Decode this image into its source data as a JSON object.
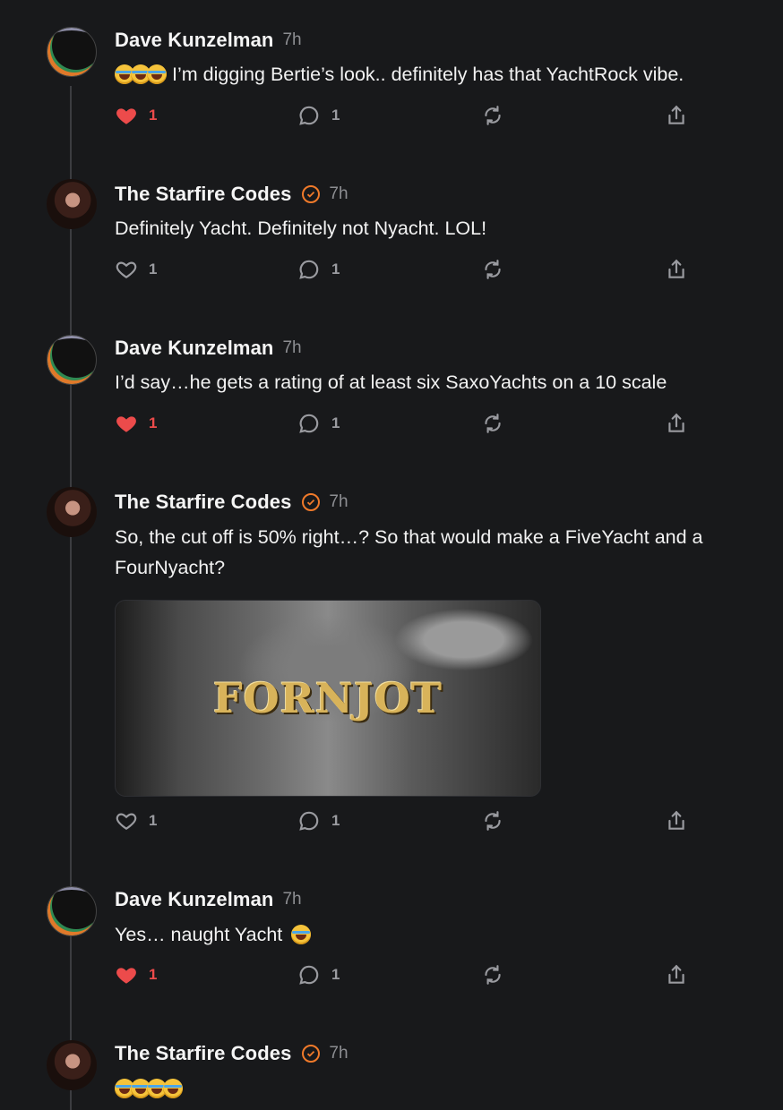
{
  "colors": {
    "background": "#18191b",
    "liked": "#ec4b4b",
    "verified": "#f07a2a",
    "muted": "#8d8e92"
  },
  "posts": [
    {
      "author": "Dave Kunzelman",
      "verified": false,
      "time": "7h",
      "emoji_count": 3,
      "text": "I’m digging Bertie’s look.. definitely has that YachtRock vibe.",
      "likes": "1",
      "liked": true,
      "replies": "1"
    },
    {
      "author": "The Starfire Codes",
      "verified": true,
      "time": "7h",
      "text": "Definitely Yacht. Definitely not Nyacht. LOL!",
      "likes": "1",
      "liked": false,
      "replies": "1"
    },
    {
      "author": "Dave Kunzelman",
      "verified": false,
      "time": "7h",
      "text": "I’d say…he gets a rating of at least six SaxoYachts on a 10 scale",
      "likes": "1",
      "liked": true,
      "replies": "1"
    },
    {
      "author": "The Starfire Codes",
      "verified": true,
      "time": "7h",
      "text": "So, the cut off is 50% right…? So that would make a FiveYacht and a FourNyacht?",
      "image_text": "FORNJOT",
      "likes": "1",
      "liked": false,
      "replies": "1"
    },
    {
      "author": "Dave Kunzelman",
      "verified": false,
      "time": "7h",
      "text": "Yes… naught Yacht",
      "emoji_count_after": 1,
      "likes": "1",
      "liked": true,
      "replies": "1"
    },
    {
      "author": "The Starfire Codes",
      "verified": true,
      "time": "7h",
      "emoji_count": 4,
      "text": ""
    }
  ]
}
